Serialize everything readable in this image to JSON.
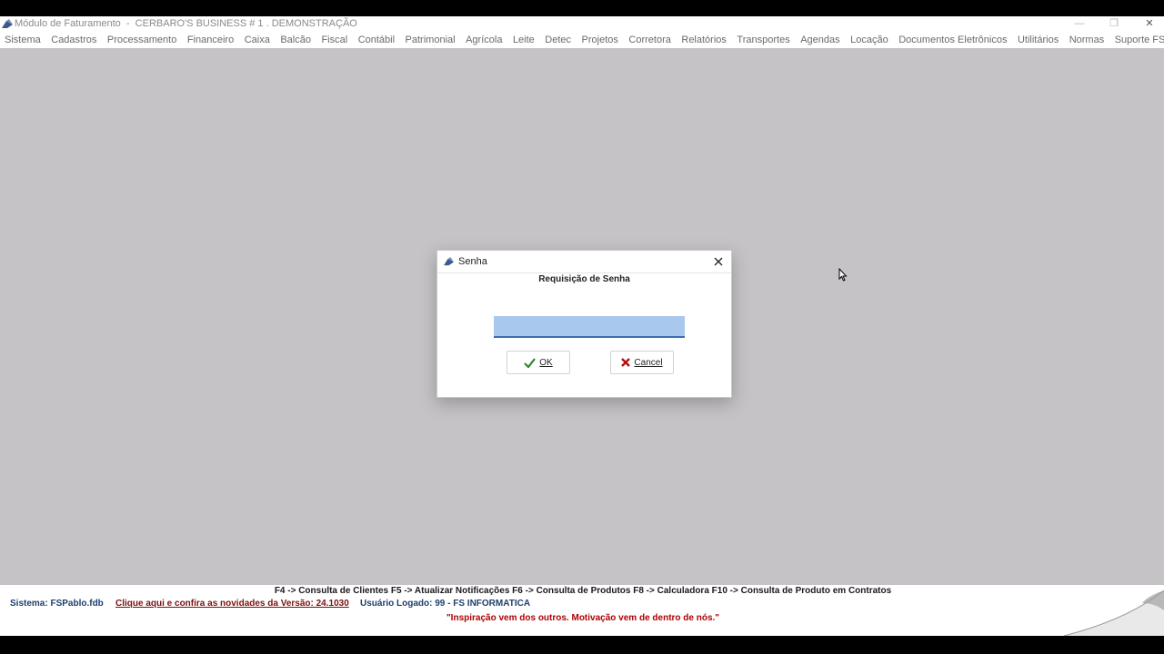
{
  "window": {
    "title": "Módulo de Faturamento  -  CERBARO'S BUSINESS # 1 . DEMONSTRAÇÃO",
    "minimize": "—",
    "restore": "❐",
    "close": "✕"
  },
  "menu": [
    "Sistema",
    "Cadastros",
    "Processamento",
    "Financeiro",
    "Caixa",
    "Balcão",
    "Fiscal",
    "Contábil",
    "Patrimonial",
    "Agrícola",
    "Leite",
    "Detec",
    "Projetos",
    "Corretora",
    "Relatórios",
    "Transportes",
    "Agendas",
    "Locação",
    "Documentos Eletrônicos",
    "Utilitários",
    "Normas",
    "Suporte FS"
  ],
  "dialog": {
    "title": "Senha",
    "heading": "Requisição de Senha",
    "password_value": "",
    "ok_label": "OK",
    "cancel_label": "Cancel"
  },
  "status": {
    "shortcuts": "F4 -> Consulta de Clientes   F5 -> Atualizar Notificações   F6 -> Consulta de Produtos   F8 -> Calculadora   F10 -> Consulta de Produto em Contratos",
    "system": "Sistema: FSPablo.fdb",
    "news_link": "Clique aqui e confira as novidades da Versão: 24.1030",
    "user": "Usuário Logado: 99 - FS INFORMATICA",
    "quote": "\"Inspiração vem dos outros. Motivação vem de dentro de nós.\""
  },
  "colors": {
    "workspace": "#c5c3c6",
    "input_fill": "#a8c8ee",
    "quote": "#b00000",
    "link": "#7a1010"
  },
  "icons": [
    "app-icon",
    "close-icon",
    "check-icon",
    "x-icon",
    "mouse-cursor-icon"
  ]
}
